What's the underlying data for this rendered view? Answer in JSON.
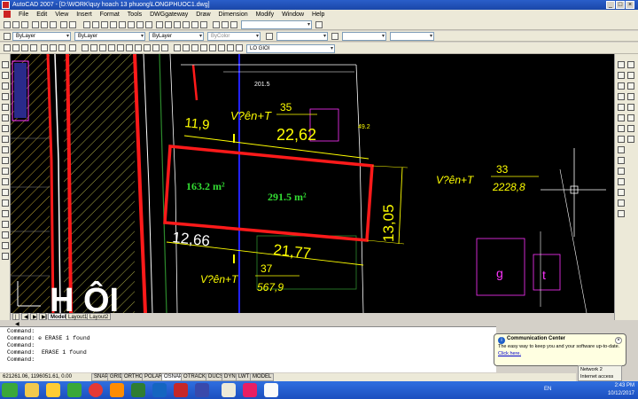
{
  "window": {
    "title": "AutoCAD 2007 - [D:\\WORK\\quy hoach 13 phuong\\LONGPHUOC1.dwg]",
    "buttons": [
      "_",
      "□",
      "×"
    ]
  },
  "menu": {
    "items": [
      "File",
      "Edit",
      "View",
      "Insert",
      "Format",
      "Tools",
      "DWGgateway",
      "Draw",
      "Dimension",
      "Modify",
      "Window",
      "Help"
    ]
  },
  "properties": {
    "layer": "ByLayer",
    "linetype": "ByLayer",
    "lineweight": "ByLayer",
    "color": "ByColor"
  },
  "layer_toolbar": {
    "layer_name": "LO GIOI"
  },
  "drawing": {
    "top_number": "201.5",
    "dim_top": "11,9",
    "label_top": "V?ên+T",
    "label_top_num": "35",
    "label_top_area": "22,62",
    "right_small": "49.2",
    "area_left": "163.2 m²",
    "area_right": "291.5 m²",
    "dim_vertical": "13,05",
    "label_right": "V?ên+T",
    "label_right_num": "33",
    "label_right_area": "2228,8",
    "dim_bottom_left": "12,66",
    "dim_bottom_right": "21,77",
    "label_bottom": "V?ên+T",
    "label_bottom_num": "37",
    "label_bottom_area": "567,9",
    "big_text": "H   ÔI",
    "block_letter_g": "g",
    "block_letter_t": "t"
  },
  "layout_tabs": [
    "Model",
    "Layout1",
    "Layout2"
  ],
  "command_lines": [
    "Command:",
    "Command: e ERASE 1 found",
    "Command:",
    "Command:  ERASE 1 found",
    "",
    "Command:"
  ],
  "status": {
    "coords": "621261.06, 1196051.61, 0.00",
    "toggles": [
      "SNAP",
      "GRID",
      "ORTHO",
      "POLAR",
      "OSNAP",
      "OTRACK",
      "DUCS",
      "DYN",
      "LWT",
      "MODEL"
    ]
  },
  "notification": {
    "title": "Communication Center",
    "body": "The easy way to keep you and your software up-to-date.",
    "link": "Click here."
  },
  "network": {
    "name": "Network  2",
    "status": "Internet access"
  },
  "tray": {
    "lang": "EN",
    "time": "2:43 PM",
    "date": "10/12/2017"
  },
  "colors": {
    "boundary_red": "#ff1a1a",
    "dim_yellow": "#ffff00",
    "area_green": "#33dd33",
    "cad_white": "#ffffff",
    "magenta": "#ff33ff",
    "axis_blue": "#2222ff"
  }
}
